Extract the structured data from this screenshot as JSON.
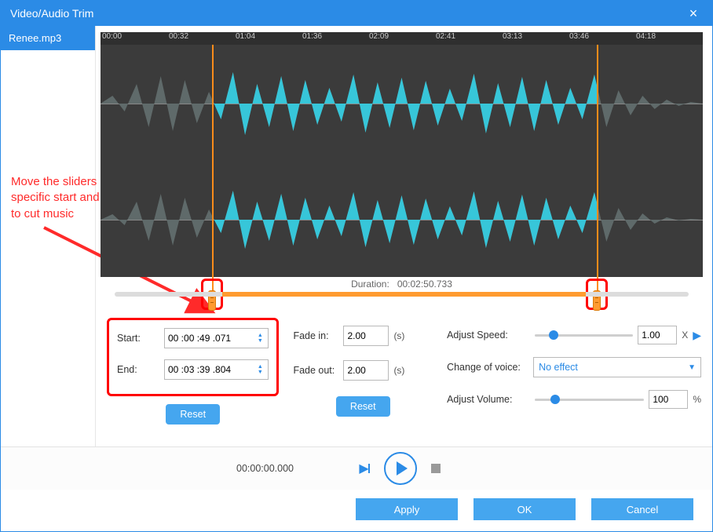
{
  "window": {
    "title": "Video/Audio Trim"
  },
  "sidebar": {
    "file": "Renee.mp3"
  },
  "annotation": "Move the sliders or set the specific start and end time to cut music",
  "ruler": [
    "00:00",
    "00:32",
    "01:04",
    "01:36",
    "02:09",
    "02:41",
    "03:13",
    "03:46",
    "04:18"
  ],
  "duration": {
    "label": "Duration:",
    "value": "00:02:50.733"
  },
  "trim": {
    "start_label": "Start:",
    "start_value": "00 :00 :49 .071",
    "end_label": "End:",
    "end_value": "00 :03 :39 .804",
    "reset": "Reset"
  },
  "fade": {
    "in_label": "Fade in:",
    "in_value": "2.00",
    "out_label": "Fade out:",
    "out_value": "2.00",
    "unit": "(s)",
    "reset": "Reset"
  },
  "adjust": {
    "speed_label": "Adjust Speed:",
    "speed_value": "1.00",
    "speed_unit": "X",
    "voice_label": "Change of voice:",
    "voice_value": "No effect",
    "volume_label": "Adjust Volume:",
    "volume_value": "100",
    "volume_unit": "%"
  },
  "playback": {
    "time": "00:00:00.000"
  },
  "buttons": {
    "apply": "Apply",
    "ok": "OK",
    "cancel": "Cancel"
  },
  "selection": {
    "start_pct": 18.5,
    "end_pct": 82.4
  },
  "sliders": {
    "speed_pct": 14,
    "volume_pct": 14
  }
}
